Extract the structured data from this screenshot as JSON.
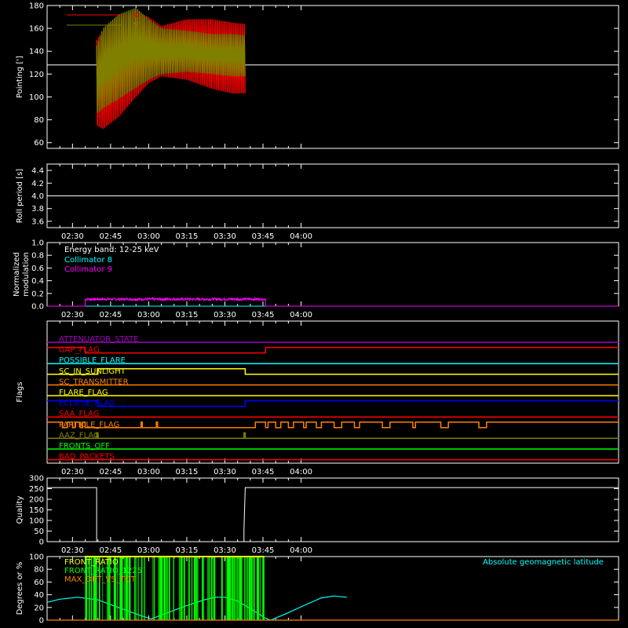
{
  "colors": {
    "background": "#000000",
    "axes": "#ffffff",
    "x": "#ff0000",
    "y": "#808000",
    "white": "#ffffff",
    "cyan": "#00ffff",
    "magenta": "#ff00ff",
    "green": "#00ff00",
    "yellow": "#ffff00",
    "orange": "#ff8000",
    "blue": "#0000ff",
    "red": "#ff0000",
    "purple": "#a000c0",
    "olive": "#808000",
    "salmon": "#ff6040"
  },
  "time_axis": {
    "range_min": [
      20,
      245
    ],
    "tick_labels": [
      "02:30",
      "02:45",
      "03:00",
      "03:15",
      "03:30",
      "03:45",
      "04:00"
    ],
    "tick_values_min": [
      30,
      45,
      60,
      75,
      90,
      105,
      120
    ]
  },
  "chart_data": [
    {
      "type": "area",
      "ylabel": "Pointing [']",
      "ylim": [
        55,
        180
      ],
      "yticks": [
        60,
        80,
        100,
        120,
        140,
        160,
        180
      ],
      "legend": [
        {
          "name": "X",
          "color": "#ff0000"
        },
        {
          "name": "Y",
          "color": "#808000"
        }
      ],
      "series": [
        {
          "name": "X",
          "color": "#ff0000",
          "x_min": [
            39.5,
            68.5
          ],
          "upper": [
            [
              39.5,
              150
            ],
            [
              42,
              158
            ],
            [
              48,
              170
            ],
            [
              55,
              175
            ],
            [
              60,
              170
            ],
            [
              65,
              162
            ],
            [
              75,
              168
            ],
            [
              85,
              168
            ],
            [
              93,
              165
            ],
            [
              98,
              164
            ]
          ],
          "lower": [
            [
              39.5,
              75
            ],
            [
              42,
              72
            ],
            [
              48,
              82
            ],
            [
              55,
              100
            ],
            [
              60,
              112
            ],
            [
              65,
              118
            ],
            [
              75,
              115
            ],
            [
              85,
              107
            ],
            [
              93,
              103
            ],
            [
              98,
              103
            ]
          ]
        },
        {
          "name": "Y",
          "color": "#808000",
          "x_min": [
            39.5,
            68.5
          ],
          "upper": [
            [
              39.5,
              145
            ],
            [
              42,
              160
            ],
            [
              48,
              172
            ],
            [
              55,
              178
            ],
            [
              60,
              168
            ],
            [
              65,
              160
            ],
            [
              75,
              158
            ],
            [
              85,
              155
            ],
            [
              93,
              155
            ],
            [
              98,
              154
            ]
          ],
          "lower": [
            [
              39.5,
              85
            ],
            [
              42,
              90
            ],
            [
              48,
              98
            ],
            [
              55,
              108
            ],
            [
              60,
              115
            ],
            [
              65,
              120
            ],
            [
              75,
              122
            ],
            [
              85,
              120
            ],
            [
              93,
              118
            ],
            [
              98,
              118
            ]
          ]
        }
      ],
      "baseline": {
        "value": 128,
        "color": "#ffffff"
      }
    },
    {
      "type": "line",
      "ylabel": "Roll period [s]",
      "ylim": [
        3.5,
        4.5
      ],
      "yticks": [
        3.6,
        3.8,
        4.0,
        4.2,
        4.4
      ],
      "series": [
        {
          "name": "",
          "color": "#ffffff",
          "points": [
            [
              20,
              4.0
            ],
            [
              245,
              4.0
            ]
          ]
        }
      ]
    },
    {
      "type": "line",
      "ylabel": "Normalized modulation",
      "ylim": [
        0,
        1.0
      ],
      "yticks": [
        0.0,
        0.2,
        0.4,
        0.6,
        0.8,
        1.0
      ],
      "annotations": [
        "Energy band: 12-25 keV"
      ],
      "legend": [
        {
          "name": "Collimator 8",
          "color": "#00ffff"
        },
        {
          "name": "Collimator 9",
          "color": "#ff00ff"
        }
      ],
      "series": [
        {
          "name": "Collimator 8",
          "color": "#00ffff",
          "points": [
            [
              20,
              0.0
            ],
            [
              245,
              0.0
            ]
          ]
        },
        {
          "name": "Collimator 9",
          "color": "#ff00ff",
          "points": [
            [
              20,
              0.0
            ],
            [
              35,
              0.0
            ],
            [
              35,
              0.11
            ],
            [
              106,
              0.11
            ],
            [
              106,
              0.0
            ],
            [
              245,
              0.0
            ]
          ]
        }
      ]
    },
    {
      "type": "line",
      "ylabel": "Flags",
      "flags": [
        {
          "name": "ATTENUATOR_STATE",
          "color": "#a000c0",
          "segments": [
            [
              20,
              0
            ],
            [
              245,
              0
            ]
          ]
        },
        {
          "name": "GAP_FLAG",
          "color": "#ff0000",
          "segments": [
            [
              20,
              1
            ],
            [
              35,
              1
            ],
            [
              35,
              0
            ],
            [
              106,
              0
            ],
            [
              106,
              1
            ],
            [
              245,
              1
            ]
          ]
        },
        {
          "name": "POSSIBLE_FLARE",
          "color": "#00ffff",
          "segments": [
            [
              20,
              0
            ],
            [
              245,
              0
            ]
          ]
        },
        {
          "name": "SC_IN_SUNLIGHT",
          "color": "#ffff00",
          "segments": [
            [
              20,
              0
            ],
            [
              40,
              0
            ],
            [
              40,
              1
            ],
            [
              98,
              1
            ],
            [
              98,
              0
            ],
            [
              245,
              0
            ]
          ]
        },
        {
          "name": "SC_TRANSMITTER",
          "color": "#ff8000",
          "segments": [
            [
              20,
              0
            ],
            [
              245,
              0
            ]
          ]
        },
        {
          "name": "FLARE_FLAG",
          "color": "#ffff00",
          "segments": [
            [
              20,
              0
            ],
            [
              245,
              0
            ]
          ]
        },
        {
          "name": "ECLIPSE_FLAG",
          "color": "#0000ff",
          "segments": [
            [
              20,
              1
            ],
            [
              40,
              1
            ],
            [
              40,
              0
            ],
            [
              98,
              0
            ],
            [
              98,
              1
            ],
            [
              245,
              1
            ]
          ]
        },
        {
          "name": "SAA_FLAG",
          "color": "#ff0000",
          "segments": [
            [
              20,
              0
            ],
            [
              245,
              0
            ]
          ]
        },
        {
          "name": "PARTICLE_FLAG",
          "color": "#ff8000",
          "segments": [
            [
              20,
              1
            ],
            [
              26,
              1
            ],
            [
              26,
              0
            ],
            [
              28,
              0
            ],
            [
              28,
              1
            ],
            [
              30,
              1
            ],
            [
              30,
              0
            ],
            [
              31,
              0
            ],
            [
              31,
              1
            ],
            [
              33,
              1
            ],
            [
              33,
              0
            ],
            [
              34,
              0
            ],
            [
              34,
              1
            ],
            [
              35,
              1
            ],
            [
              35,
              0
            ],
            [
              57,
              0
            ],
            [
              57,
              1
            ],
            [
              57.5,
              1
            ],
            [
              57.5,
              0
            ],
            [
              63,
              0
            ],
            [
              63,
              1
            ],
            [
              63.5,
              1
            ],
            [
              63.5,
              0
            ],
            [
              102,
              0
            ],
            [
              102,
              1
            ],
            [
              106,
              1
            ],
            [
              106,
              0
            ],
            [
              107,
              0
            ],
            [
              107,
              1
            ],
            [
              110,
              1
            ],
            [
              110,
              0
            ],
            [
              112,
              0
            ],
            [
              112,
              1
            ],
            [
              115,
              1
            ],
            [
              115,
              0
            ],
            [
              117,
              0
            ],
            [
              117,
              1
            ],
            [
              121,
              1
            ],
            [
              121,
              0
            ],
            [
              122,
              0
            ],
            [
              122,
              1
            ],
            [
              126,
              1
            ],
            [
              126,
              0
            ],
            [
              128,
              0
            ],
            [
              128,
              1
            ],
            [
              133,
              1
            ],
            [
              133,
              0
            ],
            [
              136,
              0
            ],
            [
              136,
              1
            ],
            [
              141,
              1
            ],
            [
              141,
              0
            ],
            [
              143,
              0
            ],
            [
              143,
              1
            ],
            [
              152,
              1
            ],
            [
              152,
              0
            ],
            [
              155,
              0
            ],
            [
              155,
              1
            ],
            [
              164,
              1
            ],
            [
              164,
              0
            ],
            [
              165,
              0
            ],
            [
              165,
              1
            ],
            [
              175,
              1
            ],
            [
              175,
              0
            ],
            [
              178,
              0
            ],
            [
              178,
              1
            ],
            [
              190,
              1
            ],
            [
              190,
              0
            ],
            [
              193,
              0
            ],
            [
              193,
              1
            ],
            [
              245,
              1
            ]
          ]
        },
        {
          "name": "AAZ_FLAG",
          "color": "#808000",
          "segments": [
            [
              20,
              0
            ],
            [
              39.5,
              0
            ],
            [
              39.5,
              1
            ],
            [
              40,
              1
            ],
            [
              40,
              0
            ],
            [
              97.5,
              0
            ],
            [
              97.5,
              1
            ],
            [
              98,
              1
            ],
            [
              98,
              0
            ],
            [
              245,
              0
            ]
          ]
        },
        {
          "name": "FRONTS_OFF",
          "color": "#00ff00",
          "segments": [
            [
              20,
              0
            ],
            [
              245,
              0
            ]
          ]
        },
        {
          "name": "BAD_PACKETS",
          "color": "#ff0000",
          "segments": [
            [
              20,
              0
            ],
            [
              245,
              0
            ]
          ]
        }
      ]
    },
    {
      "type": "line",
      "ylabel": "Quality",
      "ylim": [
        0,
        300
      ],
      "yticks": [
        0,
        50,
        100,
        150,
        200,
        250,
        300
      ],
      "series": [
        {
          "name": "",
          "color": "#ffffff",
          "points": [
            [
              20,
              255
            ],
            [
              39.5,
              255
            ],
            [
              39.5,
              0
            ],
            [
              97.5,
              0
            ],
            [
              97.5,
              60
            ],
            [
              98,
              255
            ],
            [
              245,
              255
            ]
          ]
        }
      ]
    },
    {
      "type": "line",
      "ylabel": "Degrees or %",
      "ylim": [
        0,
        100
      ],
      "yticks": [
        0,
        20,
        40,
        60,
        80,
        100
      ],
      "legend": [
        {
          "name": "FRONT_RATIO",
          "color": "#ffff00"
        },
        {
          "name": "FRONT_RATIO_1225",
          "color": "#00ff00"
        },
        {
          "name": "MAX_DET_VS_TOT",
          "color": "#ff8000"
        }
      ],
      "annotations": [
        "Absolute geomagnetic latitude"
      ],
      "series": [
        {
          "name": "Absolute geomagnetic latitude",
          "color": "#00ffff",
          "points": [
            [
              20,
              28
            ],
            [
              25,
              33
            ],
            [
              32,
              36
            ],
            [
              40,
              32
            ],
            [
              48,
              20
            ],
            [
              57,
              7
            ],
            [
              61,
              2
            ],
            [
              65,
              8
            ],
            [
              73,
              20
            ],
            [
              81,
              31
            ],
            [
              86,
              36
            ],
            [
              90,
              36
            ],
            [
              95,
              30
            ],
            [
              100,
              18
            ],
            [
              106,
              3
            ],
            [
              108,
              0
            ],
            [
              114,
              10
            ],
            [
              120,
              21
            ],
            [
              128,
              35
            ],
            [
              133,
              38
            ],
            [
              138,
              36
            ]
          ]
        },
        {
          "name": "FRONT_RATIO_1225",
          "color": "#00ff00",
          "x_min": [
            35,
            105.5
          ],
          "points": [
            [
              35,
              100
            ]
          ]
        },
        {
          "name": "FRONT_RATIO",
          "color": "#ffff00",
          "points": [
            [
              35,
              100
            ],
            [
              105.5,
              100
            ]
          ]
        },
        {
          "name": "MAX_DET_VS_TOT",
          "color": "#ff8000",
          "points": [
            [
              20,
              0
            ],
            [
              245,
              0
            ]
          ]
        }
      ]
    }
  ]
}
